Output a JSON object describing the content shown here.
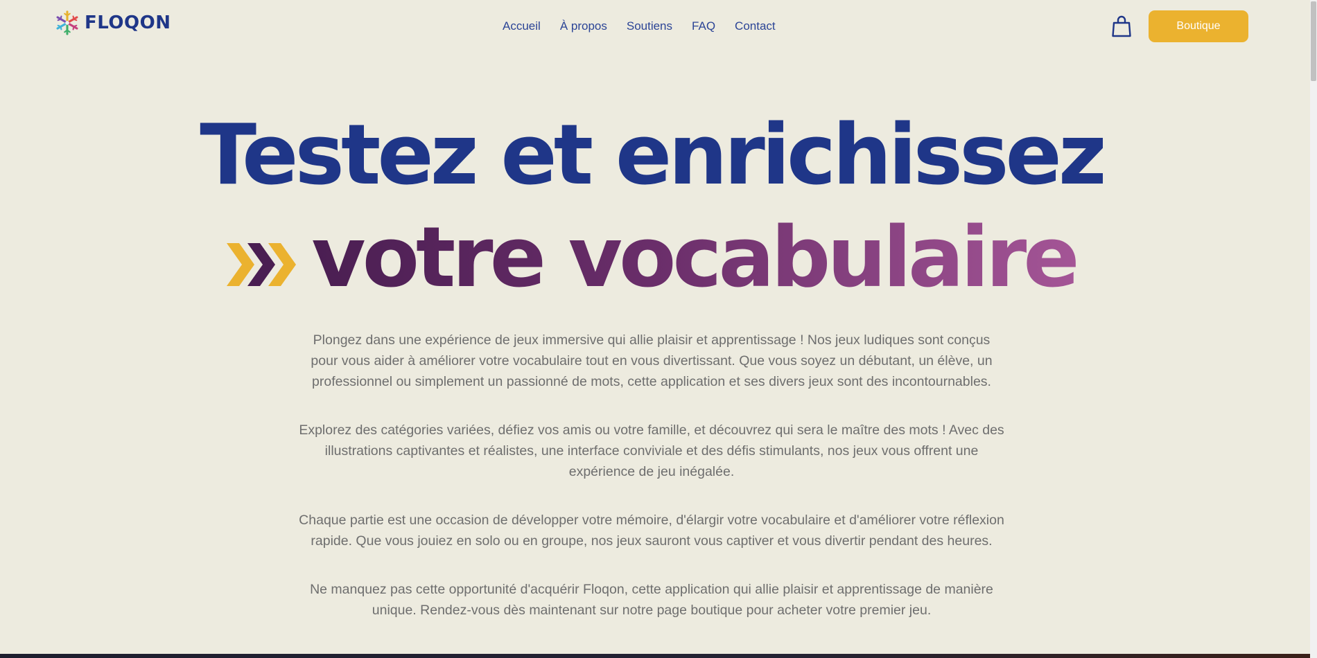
{
  "brand": {
    "name": "FLOQON",
    "logo_icon": "snowflake-logo-icon"
  },
  "nav": {
    "items": [
      {
        "label": "Accueil"
      },
      {
        "label": "À propos"
      },
      {
        "label": "Soutiens"
      },
      {
        "label": "FAQ"
      },
      {
        "label": "Contact"
      }
    ]
  },
  "header": {
    "cart_icon": "shopping-bag-icon",
    "shop_button": "Boutique"
  },
  "hero": {
    "line1": "Testez et enrichissez",
    "line2": "votre vocabulaire",
    "arrows_icon": "triple-chevron-right-icon"
  },
  "body": {
    "paragraphs": [
      "Plongez dans une expérience de jeux immersive qui allie plaisir et apprentissage ! Nos jeux ludiques sont conçus pour vous aider à améliorer votre vocabulaire tout en vous divertissant. Que vous soyez un débutant, un élève, un professionnel ou simplement un passionné de mots, cette application et ses divers jeux sont des incontournables.",
      "Explorez des catégories variées, défiez vos amis ou votre famille, et découvrez qui sera le maître des mots ! Avec des illustrations captivantes et réalistes, une interface conviviale et des défis stimulants, nos jeux vous offrent une expérience de jeu inégalée.",
      "Chaque partie est une occasion de développer votre mémoire, d'élargir votre vocabulaire et d'améliorer votre réflexion rapide. Que vous jouiez en solo ou en groupe, nos jeux sauront vous captiver et vous divertir pendant des heures.",
      "Ne manquez pas cette opportunité d'acquérir Floqon, cette application qui allie plaisir et apprentissage de manière unique. Rendez-vous dès maintenant sur notre page boutique pour acheter votre premier jeu."
    ]
  },
  "colors": {
    "background": "#edebdf",
    "primary_blue": "#1f3688",
    "accent_yellow": "#ebb22f",
    "purple": "#5a2660",
    "text_gray": "#6e6e6e"
  }
}
